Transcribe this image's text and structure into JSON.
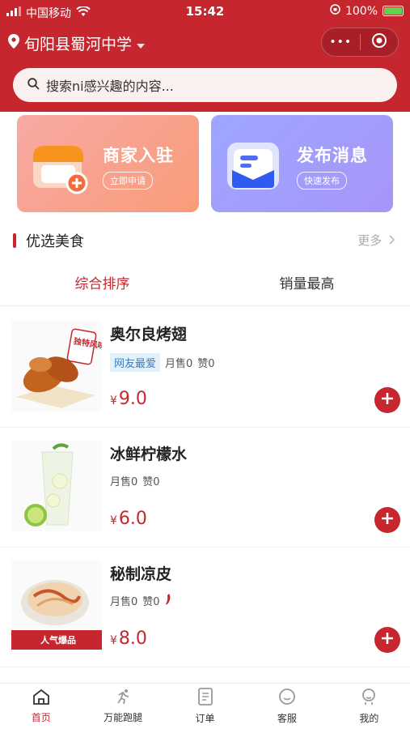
{
  "status": {
    "carrier": "中国移动",
    "time": "15:42",
    "battery": "100%"
  },
  "header": {
    "location": "旬阳县蜀河中学",
    "capsule_more": "•••"
  },
  "search": {
    "placeholder": "搜索ni感兴趣的内容..."
  },
  "banners": [
    {
      "title": "商家入驻",
      "button": "立即申请",
      "icon": "storefront-plus-icon"
    },
    {
      "title": "发布消息",
      "button": "快速发布",
      "icon": "message-envelope-icon"
    }
  ],
  "section": {
    "title": "优选美食",
    "more": "更多"
  },
  "tabs": [
    {
      "label": "综合排序",
      "active": true
    },
    {
      "label": "销量最高",
      "active": false
    }
  ],
  "items": [
    {
      "name": "奥尔良烤翅",
      "tag": "网友最爱",
      "sales": "月售0",
      "likes": "赞0",
      "currency": "¥",
      "price": "9.0",
      "badge_text": "独特风味"
    },
    {
      "name": "冰鲜柠檬水",
      "tag": "",
      "sales": "月售0",
      "likes": "赞0",
      "currency": "¥",
      "price": "6.0"
    },
    {
      "name": "秘制凉皮",
      "tag": "",
      "sales": "月售0",
      "likes": "赞0",
      "currency": "¥",
      "price": "8.0",
      "badge_text": "人气爆品"
    }
  ],
  "nav": [
    {
      "label": "首页",
      "icon": "home-icon",
      "active": true
    },
    {
      "label": "万能跑腿",
      "icon": "runner-icon",
      "active": false
    },
    {
      "label": "订单",
      "icon": "order-icon",
      "active": false
    },
    {
      "label": "客服",
      "icon": "service-icon",
      "active": false
    },
    {
      "label": "我的",
      "icon": "profile-icon",
      "active": false
    }
  ],
  "colors": {
    "brand": "#c6262e",
    "tag_bg": "#e3f1fb",
    "tag_text": "#3a7fc1"
  }
}
